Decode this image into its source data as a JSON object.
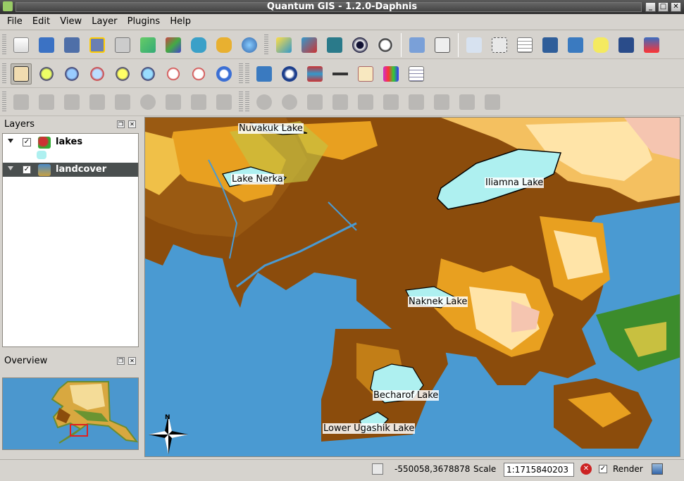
{
  "window": {
    "title": "Quantum GIS - 1.2.0-Daphnis"
  },
  "menu": [
    "File",
    "Edit",
    "View",
    "Layer",
    "Plugins",
    "Help"
  ],
  "panels": {
    "layers": {
      "title": "Layers",
      "items": [
        {
          "name": "lakes",
          "checked": true,
          "selected": false
        },
        {
          "name": "landcover",
          "checked": true,
          "selected": true
        }
      ]
    },
    "overview": {
      "title": "Overview"
    }
  },
  "map": {
    "labels": [
      {
        "text": "Nuvakuk Lake"
      },
      {
        "text": "Lake Nerka"
      },
      {
        "text": "Iliamna Lake"
      },
      {
        "text": "Naknek Lake"
      },
      {
        "text": "Becharof Lake"
      },
      {
        "text": "Lower Ugashik Lake"
      }
    ],
    "north_arrow": "N",
    "colors": {
      "water": "#4a9ad2",
      "lake": "#aef0f0",
      "forest": "#8b4c0c",
      "shrub": "#e8a020",
      "tundra": "#ffe4a8",
      "barren": "#f5c5b0",
      "grass": "#c8c040",
      "wet": "#3c8c2c"
    }
  },
  "status": {
    "coords": "-550058,3678878",
    "scale_label": "Scale",
    "scale_value": "1:1715840203",
    "render_label": "Render"
  }
}
